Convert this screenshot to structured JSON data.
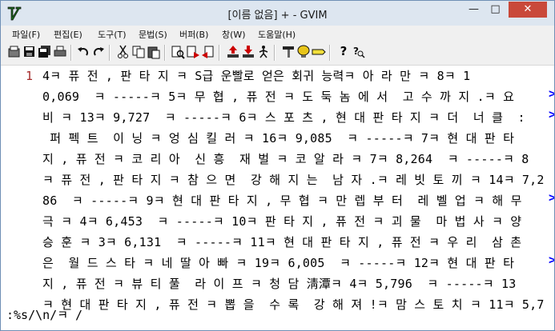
{
  "window": {
    "title": "[이름 없음] + - GVIM",
    "controls": {
      "minimize": "—",
      "maximize": "□",
      "close": "✕"
    }
  },
  "menu": [
    "파일(F)",
    "편집(E)",
    "도구(T)",
    "문법(S)",
    "버퍼(B)",
    "창(W)",
    "도움말(H)"
  ],
  "toolbar": {
    "buttons": [
      "open-icon",
      "save-icon",
      "save-all-icon",
      "print-icon",
      "undo-icon",
      "redo-icon",
      "cut-icon",
      "copy-icon",
      "paste-icon",
      "find-replace-icon",
      "find-next-icon",
      "find-prev-icon",
      "load-session-icon",
      "save-session-icon",
      "run-script-icon",
      "make-icon",
      "shell-icon",
      "ctags-icon",
      "help-icon",
      "find-help-icon"
    ]
  },
  "editor": {
    "line_number": "1",
    "lines": [
      "4ㅋ 퓨 전 , 판 타 지 ㅋ S급 운빨로 얻은 회귀 능력ㅋ 아 라 만 ㅋ 8ㅋ 1",
      "0,069  ㅋ -----ㅋ 5ㅋ 무 협 , 퓨 전 ㅋ 도 둑 놈 에 서  고 수 까 지 .ㅋ 요",
      "비 ㅋ 13ㅋ 9,727  ㅋ -----ㅋ 6ㅋ 스 포 츠 , 현 대 판 타 지 ㅋ 더  너 클  :",
      " 퍼 펙 트  이 닝 ㅋ 엉 심 킬 러 ㅋ 16ㅋ 9,085  ㅋ -----ㅋ 7ㅋ 현 대 판 타",
      "지 , 퓨 전 ㅋ 코 리 아  신 흥  재 벌 ㅋ 코 알 라 ㅋ 7ㅋ 8,264  ㅋ -----ㅋ 8",
      "ㅋ 퓨 전 , 판 타 지 ㅋ 참 으 면  강 해 지 는  남 자 .ㅋ 레 빗 토 끼 ㅋ 14ㅋ 7,2",
      "86  ㅋ -----ㅋ 9ㅋ 현 대 판 타 지 , 무 협 ㅋ 만 렙 부 터  레 벨 업 ㅋ 해 무",
      "극 ㅋ 4ㅋ 6,453  ㅋ -----ㅋ 10ㅋ 판 타 지 , 퓨 전 ㅋ 괴 물  마 법 사 ㅋ 양",
      "승 훈 ㅋ 3ㅋ 6,131  ㅋ -----ㅋ 11ㅋ 현 대 판 타 지 , 퓨 전 ㅋ 우 리  삼 촌",
      "은  월 드 스 타 ㅋ 네 딸 아 빠 ㅋ 19ㅋ 6,005  ㅋ -----ㅋ 12ㅋ 현 대 판 타",
      "지 , 퓨 전 ㅋ 뷰 티 풀  라 이 프 ㅋ 청 담 淸潭ㅋ 4ㅋ 5,796  ㅋ -----ㅋ 13",
      "ㅋ 현 대 판 타 지 , 퓨 전 ㅋ 뽑 을  수 록  강 해 져 !ㅋ 맘 스 토 치 ㅋ 11ㅋ 5,7"
    ],
    "wrap_marker": ">"
  },
  "command_line": ":%s/\\n/ㅋ /",
  "colors": {
    "line_number": "#a52a2a",
    "wrap_marker": "#0000ff",
    "close_button": "#c9493a"
  }
}
